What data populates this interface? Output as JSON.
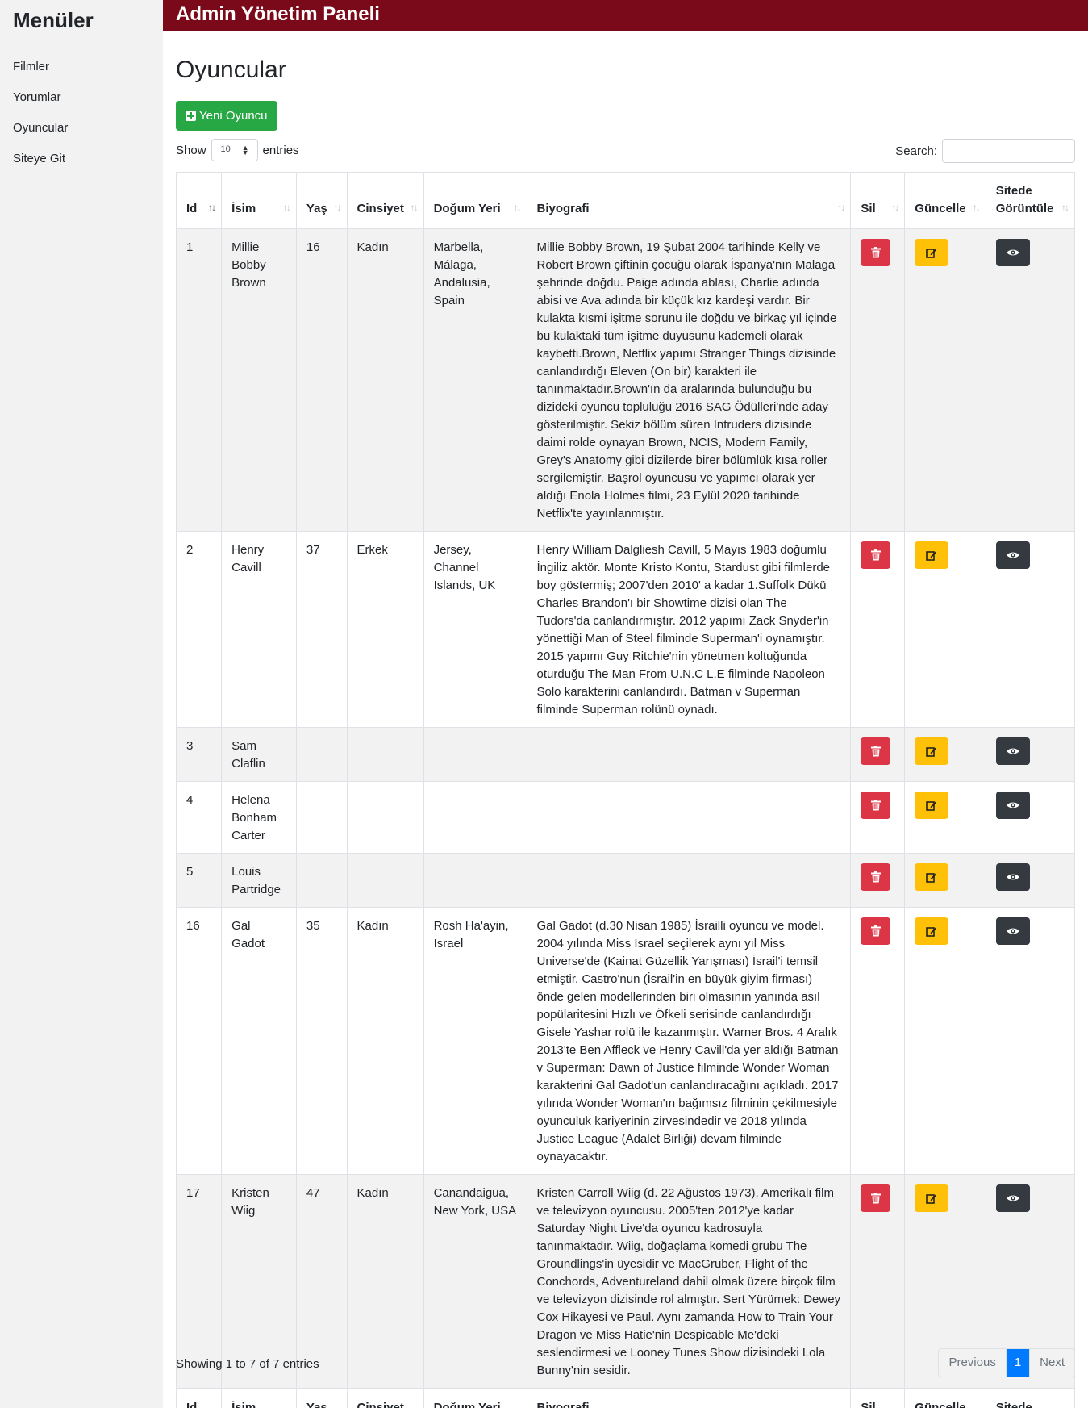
{
  "sidebar": {
    "title": "Menüler",
    "items": [
      {
        "label": "Filmler"
      },
      {
        "label": "Yorumlar"
      },
      {
        "label": "Oyuncular"
      },
      {
        "label": "Siteye Git"
      }
    ]
  },
  "header": {
    "title": "Admin Yönetim Paneli"
  },
  "page": {
    "title": "Oyuncular",
    "new_button_label": "Yeni Oyuncu"
  },
  "controls": {
    "show_label": "Show",
    "entries_label": "entries",
    "length_value": "10",
    "search_label": "Search:",
    "search_value": ""
  },
  "columns": [
    "Id",
    "İsim",
    "Yaş",
    "Cinsiyet",
    "Doğum Yeri",
    "Biyografi",
    "Sil",
    "Güncelle",
    "Sitede Görüntüle"
  ],
  "rows": [
    {
      "id": "1",
      "name": "Millie Bobby Brown",
      "age": "16",
      "gender": "Kadın",
      "birthplace": "Marbella, Málaga, Andalusia, Spain",
      "bio": "Millie Bobby Brown, 19 Şubat 2004 tarihinde Kelly ve Robert Brown çiftinin çocuğu olarak İspanya'nın Malaga şehrinde doğdu. Paige adında ablası, Charlie adında abisi ve Ava adında bir küçük kız kardeşi vardır. Bir kulakta kısmi işitme sorunu ile doğdu ve birkaç yıl içinde bu kulaktaki tüm işitme duyusunu kademeli olarak kaybetti.Brown, Netflix yapımı Stranger Things dizisinde canlandırdığı Eleven (On bir) karakteri ile tanınmaktadır.Brown'ın da aralarında bulunduğu bu dizideki oyuncu topluluğu 2016 SAG Ödülleri'nde aday gösterilmiştir. Sekiz bölüm süren Intruders dizisinde daimi rolde oynayan Brown, NCIS, Modern Family, Grey's Anatomy gibi dizilerde birer bölümlük kısa roller sergilemiştir. Başrol oyuncusu ve yapımcı olarak yer aldığı Enola Holmes filmi, 23 Eylül 2020 tarihinde Netflix'te yayınlanmıştır."
    },
    {
      "id": "2",
      "name": "Henry Cavill",
      "age": "37",
      "gender": "Erkek",
      "birthplace": "Jersey, Channel Islands, UK",
      "bio": "Henry William Dalgliesh Cavill, 5 Mayıs 1983 doğumlu İngiliz aktör. Monte Kristo Kontu, Stardust gibi filmlerde boy göstermiş; 2007'den 2010' a kadar 1.Suffolk Dükü Charles Brandon'ı bir Showtime dizisi olan The Tudors'da canlandırmıştır. 2012 yapımı Zack Snyder'in yönettiği Man of Steel filminde Superman'i oynamıştır. 2015 yapımı Guy Ritchie'nin yönetmen koltuğunda oturduğu The Man From U.N.C L.E filminde Napoleon Solo karakterini canlandırdı. Batman v Superman filminde Superman rolünü oynadı."
    },
    {
      "id": "3",
      "name": "Sam Claflin",
      "age": "",
      "gender": "",
      "birthplace": "",
      "bio": ""
    },
    {
      "id": "4",
      "name": "Helena Bonham Carter",
      "age": "",
      "gender": "",
      "birthplace": "",
      "bio": ""
    },
    {
      "id": "5",
      "name": "Louis Partridge",
      "age": "",
      "gender": "",
      "birthplace": "",
      "bio": ""
    },
    {
      "id": "16",
      "name": "Gal Gadot",
      "age": "35",
      "gender": "Kadın",
      "birthplace": "Rosh Ha'ayin, Israel",
      "bio": "Gal Gadot (d.30 Nisan 1985) İsrailli oyuncu ve model. 2004 yılında Miss Israel seçilerek aynı yıl Miss Universe'de (Kainat Güzellik Yarışması) İsrail'i temsil etmiştir. Castro'nun (İsrail'in en büyük giyim firması) önde gelen modellerinden biri olmasının yanında asıl popülaritesini Hızlı ve Öfkeli serisinde canlandırdığı Gisele Yashar rolü ile kazanmıştır. Warner Bros. 4 Aralık 2013'te Ben Affleck ve Henry Cavill'da yer aldığı Batman v Superman: Dawn of Justice filminde Wonder Woman karakterini Gal Gadot'un canlandıracağını açıkladı. 2017 yılında Wonder Woman'ın bağımsız filminin çekilmesiyle oyunculuk kariyerinin zirvesindedir ve 2018 yılında Justice League (Adalet Birliği) devam filminde oynayacaktır."
    },
    {
      "id": "17",
      "name": "Kristen Wiig",
      "age": "47",
      "gender": "Kadın",
      "birthplace": "Canandaigua, New York, USA",
      "bio": "Kristen Carroll Wiig (d. 22 Ağustos 1973), Amerikalı film ve televizyon oyuncusu. 2005'ten 2012'ye kadar Saturday Night Live'da oyuncu kadrosuyla tanınmaktadır. Wiig, doğaçlama komedi grubu The Groundlings'in üyesidir ve MacGruber, Flight of the Conchords, Adventureland dahil olmak üzere birçok film ve televizyon dizisinde rol almıştır. Sert Yürümek: Dewey Cox Hikayesi ve Paul. Aynı zamanda How to Train Your Dragon ve Miss Hatie'nin Despicable Me'deki seslendirmesi ve Looney Tunes Show dizisindeki Lola Bunny'nin sesidir."
    }
  ],
  "footer": {
    "info": "Showing 1 to 7 of 7 entries"
  },
  "pagination": {
    "previous": "Previous",
    "current": "1",
    "next": "Next"
  },
  "colors": {
    "header_bg": "#7a0a1a",
    "new_button": "#28a745",
    "delete": "#dc3545",
    "edit": "#ffc107",
    "view": "#343a40",
    "page_active": "#007bff"
  },
  "icons": {
    "delete": "trash-icon",
    "edit": "edit-icon",
    "view": "eye-icon",
    "new": "plus-square-icon"
  }
}
